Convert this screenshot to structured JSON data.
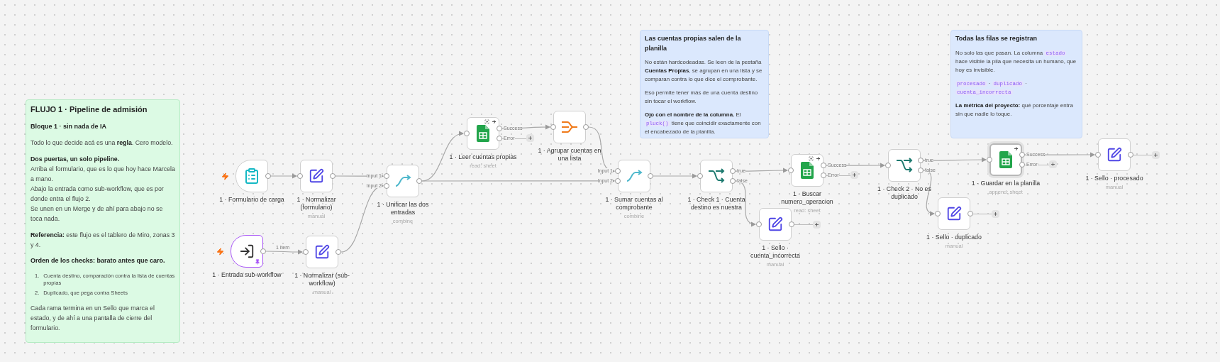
{
  "stickies": [
    {
      "kind": "green",
      "title": "FLUJO 1 · Pipeline de admisión",
      "blocks": [
        {
          "kind": "heading",
          "text": "Bloque 1 · sin nada de IA"
        },
        {
          "kind": "paragraph",
          "lines": [
            [
              {
                "kind": "text",
                "text": "Todo lo que decide acá es una **regla**. Cero modelo."
              }
            ]
          ]
        },
        {
          "kind": "paragraph",
          "lines": [
            [
              {
                "kind": "text",
                "text": "**Dos puertas, un solo pipeline.**"
              }
            ],
            [
              {
                "kind": "text",
                "text": "Arriba el formulario, que es lo que hoy hace Marcela a mano."
              }
            ],
            [
              {
                "kind": "text",
                "text": "Abajo la entrada como sub-workflow, que es por donde entra el flujo 2."
              }
            ],
            [
              {
                "kind": "text",
                "text": "Se unen en un Merge y de ahí para abajo no se toca nada."
              }
            ]
          ]
        },
        {
          "kind": "paragraph",
          "lines": [
            [
              {
                "kind": "text",
                "text": "**Referencia:** este flujo es el tablero de Miro, zonas 3 y 4."
              }
            ]
          ]
        },
        {
          "kind": "heading",
          "text": "Orden de los checks: barato antes que caro."
        },
        {
          "kind": "list",
          "items": [
            {
              "marker": "1.",
              "text": "Cuenta destino, comparación contra la lista de cuentas propias"
            },
            {
              "marker": "2.",
              "text": "Duplicado, que pega contra Sheets"
            }
          ]
        },
        {
          "kind": "paragraph",
          "lines": [
            [
              {
                "kind": "text",
                "text": "Cada rama termina en un Sello que marca el estado, y de ahí a una pantalla de cierre del formulario."
              }
            ]
          ]
        }
      ]
    },
    {
      "kind": "blue",
      "title": "Las cuentas propias salen de la planilla",
      "blocks": [
        {
          "kind": "paragraph",
          "lines": [
            [
              {
                "kind": "text",
                "text": "No están hardcodeadas. Se leen de la pestaña **Cuentas Propias**, se agrupan en una lista y se comparan contra lo que dice el comprobante."
              }
            ]
          ]
        },
        {
          "kind": "paragraph",
          "lines": [
            [
              {
                "kind": "text",
                "text": "Eso permite tener más de una cuenta destino sin tocar el workflow."
              }
            ]
          ]
        },
        {
          "kind": "paragraph",
          "lines": [
            [
              {
                "kind": "text",
                "text": "**Ojo con el nombre de la columna.** El "
              },
              {
                "kind": "code",
                "text": "pluck()"
              },
              {
                "kind": "text",
                "text": " tiene que coincidir exactamente con el encabezado de la planilla."
              }
            ]
          ]
        }
      ]
    },
    {
      "kind": "blue",
      "title": "Todas las filas se registran",
      "blocks": [
        {
          "kind": "paragraph",
          "lines": [
            [
              {
                "kind": "text",
                "text": "No solo las que pasan. La columna "
              },
              {
                "kind": "code",
                "text": "estado"
              },
              {
                "kind": "text",
                "text": " hace visible la pila que necesita un humano, que hoy es invisible."
              }
            ]
          ]
        },
        {
          "kind": "paragraph",
          "lines": [
            [
              {
                "kind": "code",
                "text": "procesado"
              },
              {
                "kind": "text",
                "text": " · "
              },
              {
                "kind": "code",
                "text": "duplicado"
              },
              {
                "kind": "text",
                "text": " · "
              },
              {
                "kind": "code",
                "text": "cuenta_incorrecta"
              }
            ]
          ]
        },
        {
          "kind": "paragraph",
          "lines": [
            [
              {
                "kind": "text",
                "text": "**La métrica del proyecto:** qué porcentaje entra sin que nadie lo toque."
              }
            ]
          ]
        }
      ]
    }
  ],
  "nodes": [
    {
      "kind": "form_trigger",
      "label": "1 · Formulario de carga",
      "pinned": false,
      "selected": false
    },
    {
      "kind": "edit",
      "label": "1 · Normalizar (formulario)",
      "subtitle": "manual",
      "pinned": false,
      "selected": false
    },
    {
      "kind": "merge",
      "label": "1 · Unificar las dos entradas",
      "subtitle": "combine",
      "pinned": false,
      "selected": false,
      "inputs": [
        "Input 1",
        "Input 2"
      ]
    },
    {
      "kind": "subworkflow_trigger",
      "label": "1 · Entrada sub-workflow",
      "pinned": true,
      "selected": false,
      "edge_label": "1 item"
    },
    {
      "kind": "edit",
      "label": "1 · Normalizar (sub-workflow)",
      "subtitle": "manual",
      "pinned": false,
      "selected": false
    },
    {
      "kind": "sheets",
      "label": "1 · Leer cuentas propias",
      "subtitle": "read: sheet",
      "pinned": false,
      "selected": false,
      "outputs": [
        "Success",
        "Error"
      ]
    },
    {
      "kind": "aggregate",
      "label": "1 · Agrupar cuentas en una lista",
      "pinned": false,
      "selected": false
    },
    {
      "kind": "merge",
      "label": "1 · Sumar cuentas al comprobante",
      "subtitle": "combine",
      "pinned": false,
      "selected": false,
      "inputs": [
        "Input 1",
        "Input 2"
      ]
    },
    {
      "kind": "if",
      "label": "1 · Check 1 · Cuenta destino es nuestra",
      "pinned": false,
      "selected": false,
      "outputs": [
        "true",
        "false"
      ]
    },
    {
      "kind": "sheets",
      "label": "1 · Buscar numero_operacion",
      "subtitle": "read: sheet",
      "pinned": false,
      "selected": false,
      "outputs": [
        "Success",
        "Error"
      ]
    },
    {
      "kind": "edit",
      "label": "1 · Sello · cuenta_incorrecta",
      "subtitle": "manual",
      "pinned": false,
      "selected": false
    },
    {
      "kind": "if",
      "label": "1 · Check 2 · No es duplicado",
      "pinned": false,
      "selected": false,
      "outputs": [
        "true",
        "false"
      ]
    },
    {
      "kind": "edit",
      "label": "1 · Sello · duplicado",
      "subtitle": "manual",
      "pinned": false,
      "selected": false
    },
    {
      "kind": "sheets",
      "label": "1 · Guardar en la planilla",
      "subtitle": "append: sheet",
      "pinned": false,
      "selected": true,
      "outputs": [
        "Success",
        "Error"
      ]
    },
    {
      "kind": "edit",
      "label": "1 · Sello · procesado",
      "subtitle": "manual",
      "pinned": false,
      "selected": false
    }
  ]
}
